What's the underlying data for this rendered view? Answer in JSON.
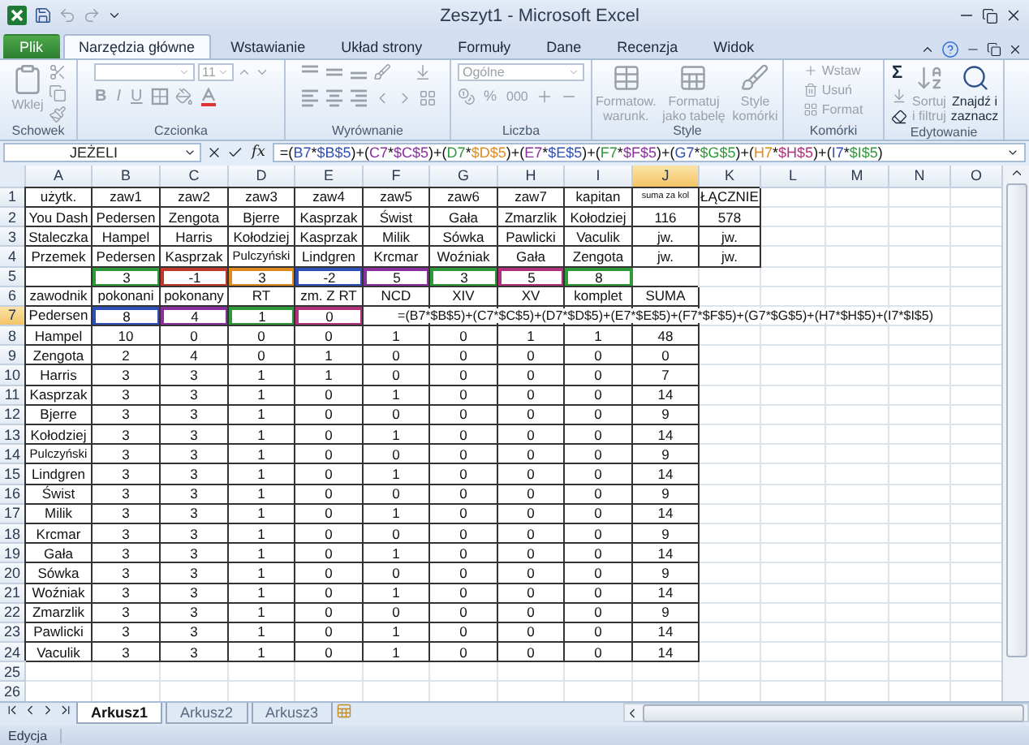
{
  "title_bar": {
    "title": "Zeszyt1 - Microsoft Excel"
  },
  "ribbon_tabs": [
    {
      "label": "Plik",
      "kind": "file",
      "selected": false
    },
    {
      "label": "Narzędzia główne",
      "kind": "tab",
      "selected": true
    },
    {
      "label": "Wstawianie",
      "kind": "tab",
      "selected": false
    },
    {
      "label": "Układ strony",
      "kind": "tab",
      "selected": false
    },
    {
      "label": "Formuły",
      "kind": "tab",
      "selected": false
    },
    {
      "label": "Dane",
      "kind": "tab",
      "selected": false
    },
    {
      "label": "Recenzja",
      "kind": "tab",
      "selected": false
    },
    {
      "label": "Widok",
      "kind": "tab",
      "selected": false
    }
  ],
  "ribbon": {
    "clipboard": {
      "label": "Schowek",
      "disabled": true,
      "paste": "Wklej"
    },
    "font": {
      "label": "Czcionka",
      "disabled": true,
      "size": "11",
      "bold": "B",
      "italic": "I",
      "underline": "U"
    },
    "alignment": {
      "label": "Wyrównanie",
      "disabled": true
    },
    "number": {
      "label": "Liczba",
      "disabled": true,
      "format": "Ogólne",
      "percent": "%",
      "thousands": "000"
    },
    "styles": {
      "label": "Style",
      "disabled": true,
      "buttons": [
        "Formatow. warunk.",
        "Formatuj jako tabelę",
        "Style komórki"
      ]
    },
    "cells": {
      "label": "Komórki",
      "disabled": true,
      "buttons": [
        "Wstaw",
        "Usuń",
        "Format"
      ]
    },
    "editing": {
      "label": "Edytowanie",
      "sum": {
        "label": "Σ",
        "disabled": false
      },
      "buttons": [
        {
          "label": "Sortuj i filtruj",
          "disabled": true
        },
        {
          "label": "Znajdź i zaznacz",
          "disabled": false
        }
      ]
    }
  },
  "formula_bar": {
    "name_box": "JEŻELI",
    "fx": "fx",
    "formula": [
      {
        "text": "=("
      },
      {
        "text": "B7",
        "color": "#2f4fb8"
      },
      {
        "text": "*"
      },
      {
        "text": "$B$5",
        "color": "#2f4fb8"
      },
      {
        "text": ")+("
      },
      {
        "text": "C7",
        "color": "#8a2f9e"
      },
      {
        "text": "*"
      },
      {
        "text": "$C$5",
        "color": "#8a2f9e"
      },
      {
        "text": ")+("
      },
      {
        "text": "D7",
        "color": "#2f9a3a"
      },
      {
        "text": "*"
      },
      {
        "text": "$D$5",
        "color": "#e08a1e"
      },
      {
        "text": ")+("
      },
      {
        "text": "E7",
        "color": "#8a2f9e"
      },
      {
        "text": "*"
      },
      {
        "text": "$E$5",
        "color": "#2f4fb8"
      },
      {
        "text": ")+("
      },
      {
        "text": "F7",
        "color": "#2f9a3a"
      },
      {
        "text": "*"
      },
      {
        "text": "$F$5",
        "color": "#8a2f9e"
      },
      {
        "text": ")+("
      },
      {
        "text": "G7",
        "color": "#2f4fb8"
      },
      {
        "text": "*"
      },
      {
        "text": "$G$5",
        "color": "#2f9a3a"
      },
      {
        "text": ")+("
      },
      {
        "text": "H7",
        "color": "#e08a1e"
      },
      {
        "text": "*"
      },
      {
        "text": "$H$5",
        "color": "#b0307a"
      },
      {
        "text": ")+("
      },
      {
        "text": "I7",
        "color": "#2f4fb8"
      },
      {
        "text": "*"
      },
      {
        "text": "$I$5",
        "color": "#2f9a3a"
      },
      {
        "text": ")"
      }
    ]
  },
  "sheet": {
    "columns": [
      {
        "label": "A",
        "selected": false
      },
      {
        "label": "B",
        "selected": false
      },
      {
        "label": "C",
        "selected": false
      },
      {
        "label": "D",
        "selected": false
      },
      {
        "label": "E",
        "selected": false
      },
      {
        "label": "F",
        "selected": false
      },
      {
        "label": "G",
        "selected": false
      },
      {
        "label": "H",
        "selected": false
      },
      {
        "label": "I",
        "selected": false
      },
      {
        "label": "J",
        "selected": true
      },
      {
        "label": "K",
        "selected": false
      },
      {
        "label": "L",
        "selected": false
      },
      {
        "label": "M",
        "selected": false
      },
      {
        "label": "N",
        "selected": false
      },
      {
        "label": "O",
        "selected": false
      }
    ],
    "rows": [
      {
        "number": "1",
        "selected": false,
        "cells": [
          "użytk.",
          "zaw1",
          "zaw2",
          "zaw3",
          "zaw4",
          "zaw5",
          "zaw6",
          "zaw7",
          "kapitan",
          "suma za kol",
          "ŁĄCZNIE"
        ]
      },
      {
        "number": "2",
        "selected": false,
        "cells": [
          "You Dash",
          "Pedersen",
          "Zengota",
          "Bjerre",
          "Kasprzak",
          "Świst",
          "Gała",
          "Zmarzlik",
          "Kołodziej",
          "116",
          "578"
        ]
      },
      {
        "number": "3",
        "selected": false,
        "cells": [
          "Staleczka",
          "Hampel",
          "Harris",
          "Kołodziej",
          "Kasprzak",
          "Milik",
          "Sówka",
          "Pawlicki",
          "Vaculik",
          "jw.",
          "jw."
        ]
      },
      {
        "number": "4",
        "selected": false,
        "cells": [
          "Przemek",
          "Pedersen",
          "Kasprzak",
          "Pulczyński",
          "Lindgren",
          "Krcmar",
          "Woźniak",
          "Gała",
          "Zengota",
          "jw.",
          "jw."
        ]
      },
      {
        "number": "5",
        "selected": false,
        "cells": [
          null,
          {
            "text": "3",
            "color": "#2f9a3a"
          },
          {
            "text": "-1",
            "color": "#c0392b"
          },
          {
            "text": "3",
            "color": "#e08a1e"
          },
          {
            "text": "-2",
            "color": "#2f4fb8"
          },
          {
            "text": "5",
            "color": "#8a2f9e"
          },
          {
            "text": "3",
            "color": "#2f9a3a"
          },
          {
            "text": "5",
            "color": "#b0307a"
          },
          {
            "text": "8",
            "color": "#2f9a3a"
          }
        ]
      },
      {
        "number": "6",
        "selected": false,
        "cells": [
          "zawodnik",
          "pokonani",
          "pokonany",
          "RT",
          "zm. Z RT",
          "NCD",
          "XIV",
          "XV",
          "komplet",
          "SUMA"
        ]
      },
      {
        "number": "7",
        "selected": true,
        "cells": [
          "Pedersen",
          {
            "text": "8",
            "color": "#2f4fb8"
          },
          {
            "text": "4",
            "color": "#8a2f9e"
          },
          {
            "text": "1",
            "color": "#2f9a3a"
          },
          {
            "text": "0",
            "color": "#b0307a"
          },
          null,
          null,
          null,
          null,
          null
        ],
        "editing_text": "=(B7*$B$5)+(C7*$C$5)+(D7*$D$5)+(E7*$E$5)+(F7*$F$5)+(G7*$G$5)+(H7*$H$5)+(I7*$I$5)"
      },
      {
        "number": "8",
        "selected": false,
        "cells": [
          "Hampel",
          "10",
          "0",
          "0",
          "0",
          "1",
          "0",
          "1",
          "1",
          "48"
        ]
      },
      {
        "number": "9",
        "selected": false,
        "cells": [
          "Zengota",
          "2",
          "4",
          "0",
          "1",
          "0",
          "0",
          "0",
          "0",
          "0"
        ]
      },
      {
        "number": "10",
        "selected": false,
        "cells": [
          "Harris",
          "3",
          "3",
          "1",
          "1",
          "0",
          "0",
          "0",
          "0",
          "7"
        ]
      },
      {
        "number": "11",
        "selected": false,
        "cells": [
          "Kasprzak",
          "3",
          "3",
          "1",
          "0",
          "1",
          "0",
          "0",
          "0",
          "14"
        ]
      },
      {
        "number": "12",
        "selected": false,
        "cells": [
          "Bjerre",
          "3",
          "3",
          "1",
          "0",
          "0",
          "0",
          "0",
          "0",
          "9"
        ]
      },
      {
        "number": "13",
        "selected": false,
        "cells": [
          "Kołodziej",
          "3",
          "3",
          "1",
          "0",
          "1",
          "0",
          "0",
          "0",
          "14"
        ]
      },
      {
        "number": "14",
        "selected": false,
        "cells": [
          "Pulczyński",
          "3",
          "3",
          "1",
          "0",
          "0",
          "0",
          "0",
          "0",
          "9"
        ]
      },
      {
        "number": "15",
        "selected": false,
        "cells": [
          "Lindgren",
          "3",
          "3",
          "1",
          "0",
          "1",
          "0",
          "0",
          "0",
          "14"
        ]
      },
      {
        "number": "16",
        "selected": false,
        "cells": [
          "Świst",
          "3",
          "3",
          "1",
          "0",
          "0",
          "0",
          "0",
          "0",
          "9"
        ]
      },
      {
        "number": "17",
        "selected": false,
        "cells": [
          "Milik",
          "3",
          "3",
          "1",
          "0",
          "1",
          "0",
          "0",
          "0",
          "14"
        ]
      },
      {
        "number": "18",
        "selected": false,
        "cells": [
          "Krcmar",
          "3",
          "3",
          "1",
          "0",
          "0",
          "0",
          "0",
          "0",
          "9"
        ]
      },
      {
        "number": "19",
        "selected": false,
        "cells": [
          "Gała",
          "3",
          "3",
          "1",
          "0",
          "1",
          "0",
          "0",
          "0",
          "14"
        ]
      },
      {
        "number": "20",
        "selected": false,
        "cells": [
          "Sówka",
          "3",
          "3",
          "1",
          "0",
          "0",
          "0",
          "0",
          "0",
          "9"
        ]
      },
      {
        "number": "21",
        "selected": false,
        "cells": [
          "Woźniak",
          "3",
          "3",
          "1",
          "0",
          "1",
          "0",
          "0",
          "0",
          "14"
        ]
      },
      {
        "number": "22",
        "selected": false,
        "cells": [
          "Zmarzlik",
          "3",
          "3",
          "1",
          "0",
          "0",
          "0",
          "0",
          "0",
          "9"
        ]
      },
      {
        "number": "23",
        "selected": false,
        "cells": [
          "Pawlicki",
          "3",
          "3",
          "1",
          "0",
          "1",
          "0",
          "0",
          "0",
          "14"
        ]
      },
      {
        "number": "24",
        "selected": false,
        "cells": [
          "Vaculik",
          "3",
          "3",
          "1",
          "0",
          "1",
          "0",
          "0",
          "0",
          "14"
        ]
      },
      {
        "number": "25",
        "selected": false,
        "cells": []
      },
      {
        "number": "26",
        "selected": false,
        "cells": []
      }
    ]
  },
  "sheet_tabs": [
    {
      "label": "Arkusz1",
      "selected": true
    },
    {
      "label": "Arkusz2",
      "selected": false
    },
    {
      "label": "Arkusz3",
      "selected": false
    }
  ],
  "status_bar": {
    "mode": "Edycja"
  }
}
